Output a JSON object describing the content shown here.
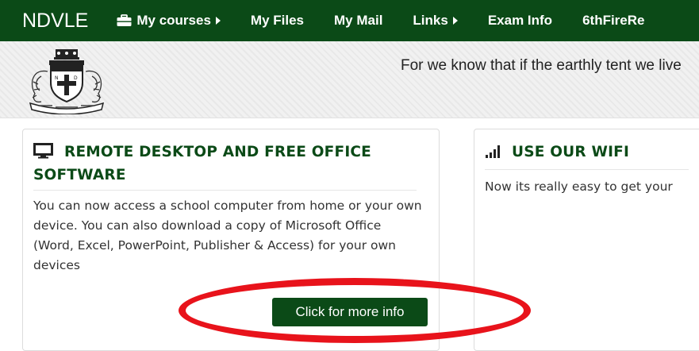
{
  "navbar": {
    "brand": "NDVLE",
    "items": [
      {
        "label": "My courses",
        "icon": "briefcase-icon",
        "has_caret": true
      },
      {
        "label": "My Files"
      },
      {
        "label": "My Mail"
      },
      {
        "label": "Links",
        "has_caret": true
      },
      {
        "label": "Exam Info"
      },
      {
        "label": "6thFireRe"
      }
    ],
    "bg_color": "#0b4a17"
  },
  "header": {
    "crest_icon": "school-crest-icon",
    "marquee_text": "For we know that if the earthly tent we live"
  },
  "cards": [
    {
      "icon": "monitor-icon",
      "title": "REMOTE DESKTOP AND FREE OFFICE SOFTWARE",
      "body": "You can now access a school computer from home or your own device.  You can also download a copy of Microsoft Office (Word, Excel, PowerPoint, Publisher & Access) for your own devices",
      "button_label": "Click for more info"
    },
    {
      "icon": "signal-icon",
      "title": "USE OUR WIFI",
      "body": "Now its really easy to get your"
    }
  ],
  "accent_color": "#0b4a17",
  "highlight_color": "#e8131b"
}
